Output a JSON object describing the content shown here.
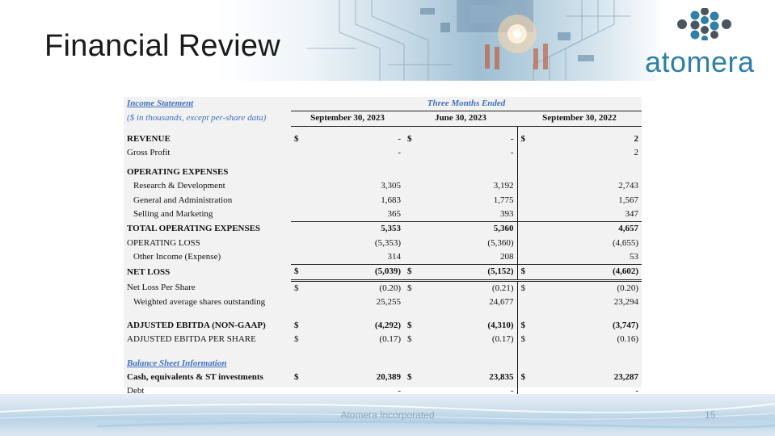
{
  "slide": {
    "title": "Financial Review",
    "footer": "Atomera Incorporated",
    "page_number": "15"
  },
  "logo": {
    "wordmark": "atomera",
    "accent": "#2f7fa6",
    "dot_color": "#4a5560"
  },
  "table": {
    "section_label": "Income Statement",
    "units_note": "($ in thousands, except per-share data)",
    "period_header": "Three Months Ended",
    "columns": [
      "September 30, 2023",
      "June 30, 2023",
      "September 30, 2022"
    ],
    "rows": [
      {
        "label": "REVENUE",
        "c1": [
          "$",
          "-"
        ],
        "c2": [
          "$",
          "-"
        ],
        "c3": [
          "$",
          "2"
        ]
      },
      {
        "label": "Gross Profit",
        "c1": [
          "",
          "-"
        ],
        "c2": [
          "",
          "-"
        ],
        "c3": [
          "",
          "2"
        ]
      },
      {
        "label": "OPERATING EXPENSES"
      },
      {
        "label": "Research & Development",
        "c1": [
          "",
          "3,305"
        ],
        "c2": [
          "",
          "3,192"
        ],
        "c3": [
          "",
          "2,743"
        ]
      },
      {
        "label": "General and Administration",
        "c1": [
          "",
          "1,683"
        ],
        "c2": [
          "",
          "1,775"
        ],
        "c3": [
          "",
          "1,567"
        ]
      },
      {
        "label": "Selling and Marketing",
        "c1": [
          "",
          "365"
        ],
        "c2": [
          "",
          "393"
        ],
        "c3": [
          "",
          "347"
        ]
      },
      {
        "label": "TOTAL OPERATING EXPENSES",
        "c1": [
          "",
          "5,353"
        ],
        "c2": [
          "",
          "5,360"
        ],
        "c3": [
          "",
          "4,657"
        ]
      },
      {
        "label": "OPERATING LOSS",
        "c1": [
          "",
          "(5,353)"
        ],
        "c2": [
          "",
          "(5,360)"
        ],
        "c3": [
          "",
          "(4,655)"
        ]
      },
      {
        "label": "Other Income (Expense)",
        "c1": [
          "",
          "314"
        ],
        "c2": [
          "",
          "208"
        ],
        "c3": [
          "",
          "53"
        ]
      },
      {
        "label": "NET LOSS",
        "c1": [
          "$",
          "(5,039)"
        ],
        "c2": [
          "$",
          "(5,152)"
        ],
        "c3": [
          "$",
          "(4,602)"
        ]
      },
      {
        "label": "Net Loss Per Share",
        "c1": [
          "$",
          "(0.20)"
        ],
        "c2": [
          "$",
          "(0.21)"
        ],
        "c3": [
          "$",
          "(0.20)"
        ]
      },
      {
        "label": "Weighted average shares outstanding",
        "c1": [
          "",
          "25,255"
        ],
        "c2": [
          "",
          "24,677"
        ],
        "c3": [
          "",
          "23,294"
        ]
      },
      {
        "label": "ADJUSTED EBITDA (NON-GAAP)",
        "c1": [
          "$",
          "(4,292)"
        ],
        "c2": [
          "$",
          "(4,310)"
        ],
        "c3": [
          "$",
          "(3,747)"
        ]
      },
      {
        "label": "ADJUSTED EBITDA PER SHARE",
        "c1": [
          "$",
          "(0.17)"
        ],
        "c2": [
          "$",
          "(0.17)"
        ],
        "c3": [
          "$",
          "(0.16)"
        ]
      },
      {
        "label": "Balance Sheet Information"
      },
      {
        "label": "Cash, equivalents & ST investments",
        "c1": [
          "$",
          "20,389"
        ],
        "c2": [
          "$",
          "23,835"
        ],
        "c3": [
          "$",
          "23,287"
        ]
      },
      {
        "label": "Debt",
        "c1": [
          "",
          "-"
        ],
        "c2": [
          "",
          "-"
        ],
        "c3": [
          "",
          "-"
        ]
      }
    ]
  }
}
